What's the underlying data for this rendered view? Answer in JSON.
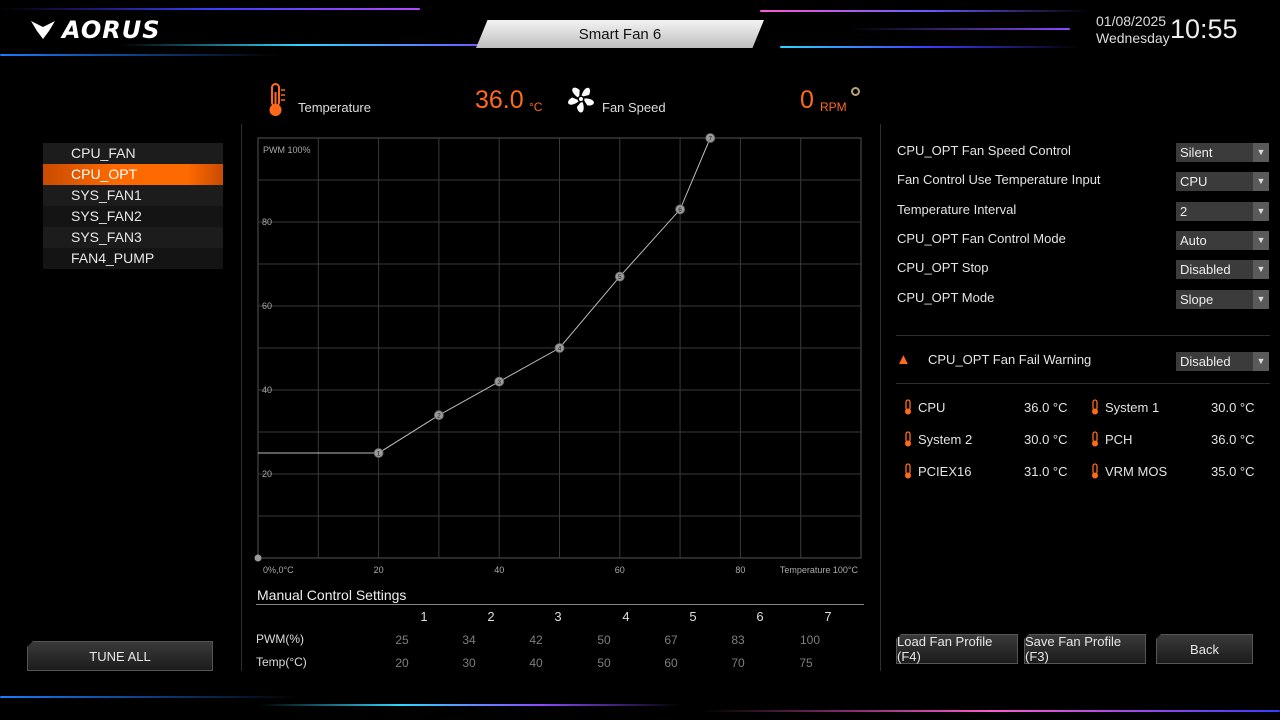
{
  "header": {
    "brand": "AORUS",
    "title": "Smart Fan 6",
    "date": "01/08/2025",
    "weekday": "Wednesday",
    "time": "10:55"
  },
  "fan_list": [
    "CPU_FAN",
    "CPU_OPT",
    "SYS_FAN1",
    "SYS_FAN2",
    "SYS_FAN3",
    "FAN4_PUMP"
  ],
  "selected_fan": "CPU_OPT",
  "readouts": {
    "temperature_label": "Temperature",
    "temperature_value": "36.0",
    "temperature_unit": "°C",
    "fan_speed_label": "Fan Speed",
    "fan_speed_value": "0",
    "fan_speed_unit": "RPM"
  },
  "tune_all_label": "TUNE ALL",
  "chart_data": {
    "type": "line",
    "y_top_label": "PWM 100%",
    "origin_label": "0%,0°C",
    "x_end_label": "Temperature 100°C",
    "x_ticks": [
      "20",
      "40",
      "60",
      "80"
    ],
    "y_ticks": [
      "20",
      "40",
      "60",
      "80"
    ],
    "xlim": [
      0,
      100
    ],
    "ylim": [
      0,
      100
    ],
    "grid": true,
    "points": [
      {
        "n": "1",
        "x": 20,
        "y": 25
      },
      {
        "n": "2",
        "x": 30,
        "y": 34
      },
      {
        "n": "3",
        "x": 40,
        "y": 42
      },
      {
        "n": "4",
        "x": 50,
        "y": 50
      },
      {
        "n": "5",
        "x": 60,
        "y": 67
      },
      {
        "n": "6",
        "x": 70,
        "y": 83
      },
      {
        "n": "7",
        "x": 75,
        "y": 100
      }
    ],
    "origin_point": {
      "x": 0,
      "y": 0
    }
  },
  "manual_control": {
    "title": "Manual Control Settings",
    "columns": [
      "1",
      "2",
      "3",
      "4",
      "5",
      "6",
      "7"
    ],
    "pwm_label": "PWM(%)",
    "temp_label": "Temp(°C)",
    "pwm": [
      "25",
      "34",
      "42",
      "50",
      "67",
      "83",
      "100"
    ],
    "temp": [
      "20",
      "30",
      "40",
      "50",
      "60",
      "70",
      "75"
    ]
  },
  "settings": [
    {
      "label": "CPU_OPT Fan Speed Control",
      "value": "Silent"
    },
    {
      "label": "Fan Control Use Temperature Input",
      "value": "CPU"
    },
    {
      "label": "Temperature Interval",
      "value": "2"
    },
    {
      "label": "CPU_OPT Fan Control Mode",
      "value": "Auto"
    },
    {
      "label": "CPU_OPT Stop",
      "value": "Disabled"
    },
    {
      "label": "CPU_OPT Mode",
      "value": "Slope"
    }
  ],
  "fail_warning": {
    "label": "CPU_OPT Fan Fail Warning",
    "value": "Disabled"
  },
  "sensors": [
    {
      "name": "CPU",
      "value": "36.0 °C"
    },
    {
      "name": "System 1",
      "value": "30.0 °C"
    },
    {
      "name": "System 2",
      "value": "30.0 °C"
    },
    {
      "name": "PCH",
      "value": "36.0 °C"
    },
    {
      "name": "PCIEX16",
      "value": "31.0 °C"
    },
    {
      "name": "VRM MOS",
      "value": "35.0 °C"
    }
  ],
  "buttons": {
    "load": "Load Fan Profile (F4)",
    "save": "Save Fan Profile (F3)",
    "back": "Back"
  },
  "colors": {
    "accent": "#ff6a1a",
    "selected_bg": "#ff6a00",
    "grid": "#3a3a3a"
  }
}
